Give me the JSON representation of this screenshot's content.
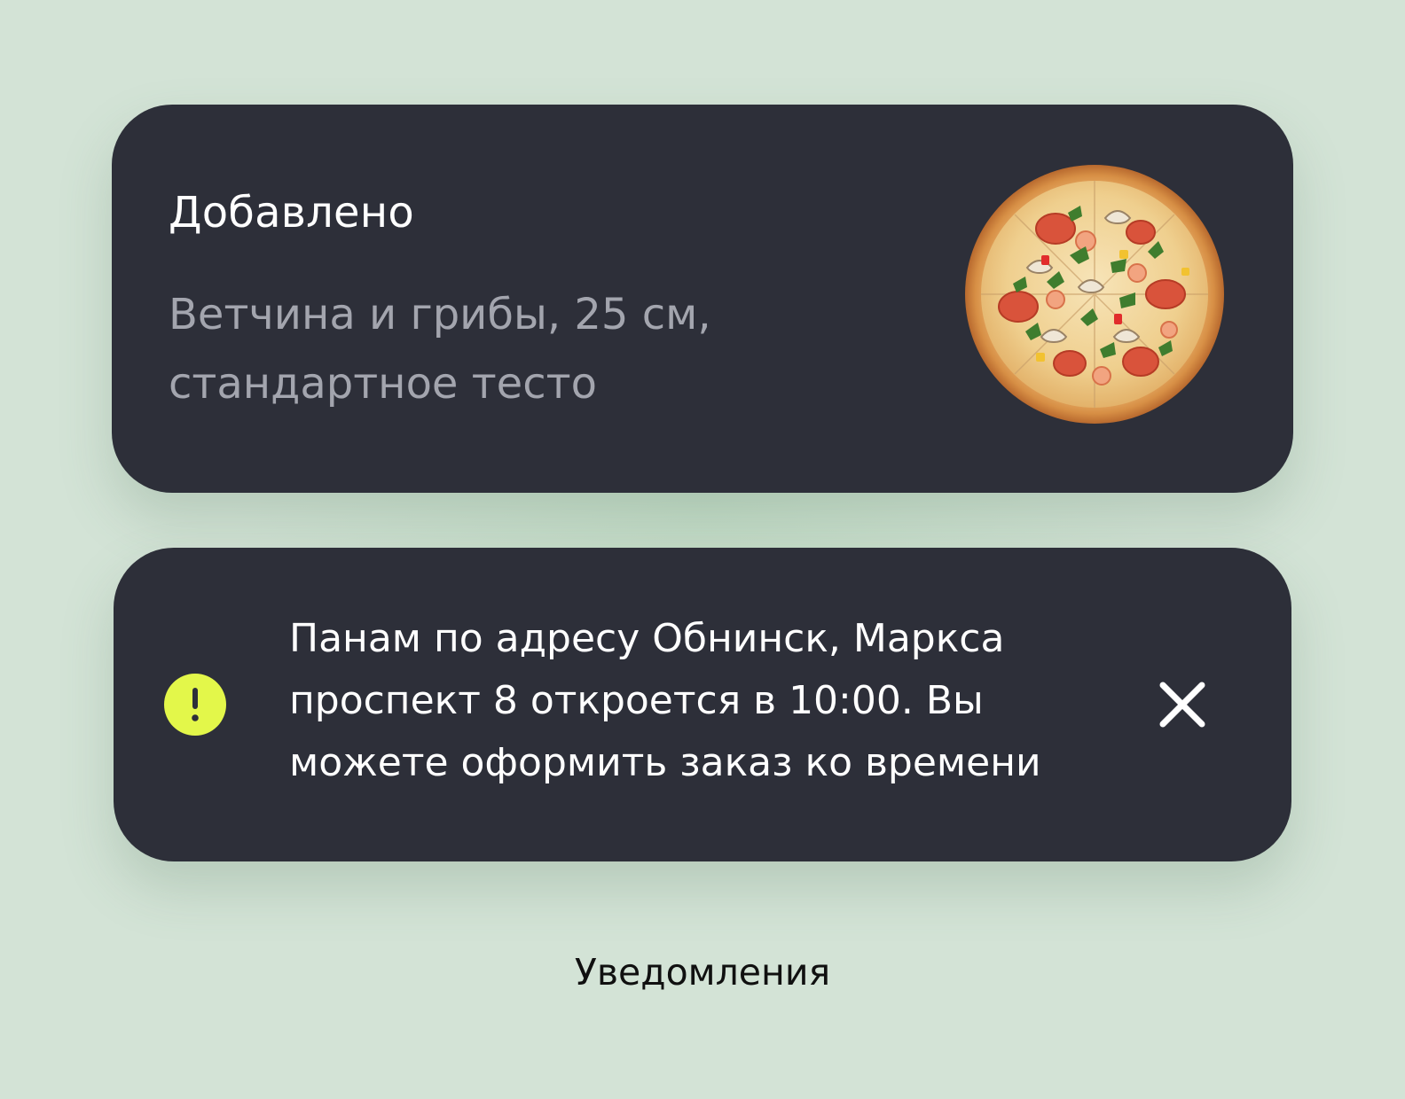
{
  "notifications": {
    "added": {
      "title": "Добавлено",
      "description": "Ветчина и грибы, 25 см, стандартное тесто",
      "image_icon": "pizza-image"
    },
    "info": {
      "icon": "exclamation-icon",
      "icon_color": "#e3f74a",
      "message": "Панам по адресу Обнинск, Маркса проспект 8 откроется в 10:00. Вы можете оформить заказ ко времени",
      "close_icon": "close-icon"
    }
  },
  "caption": "Уведомления",
  "colors": {
    "background": "#d3e3d6",
    "toast_bg": "#2d2f39",
    "accent": "#e3f74a",
    "subtext": "#a3a5ae"
  }
}
